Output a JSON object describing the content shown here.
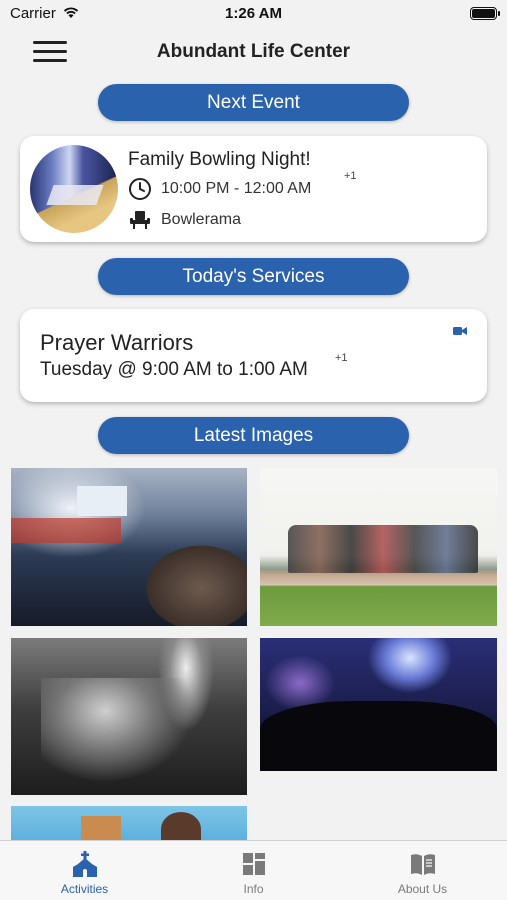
{
  "status_bar": {
    "carrier": "Carrier",
    "time": "1:26 AM"
  },
  "nav": {
    "title": "Abundant Life Center",
    "menu_icon": "hamburger-menu-icon"
  },
  "sections": {
    "next_event": "Next Event",
    "todays_services": "Today's Services",
    "latest_images": "Latest Images"
  },
  "event": {
    "title": "Family Bowling Night!",
    "time": "10:00 PM - 12:00 AM",
    "time_extra": "+1",
    "location": "Bowlerama",
    "time_icon": "clock-icon",
    "location_icon": "seat-icon"
  },
  "service": {
    "title": "Prayer Warriors",
    "when": "Tuesday @ 9:00 AM to 1:00 AM",
    "when_extra": "+1",
    "icon": "video-camera-icon"
  },
  "tabs": [
    {
      "label": "Activities",
      "icon": "church-icon",
      "active": true
    },
    {
      "label": "Info",
      "icon": "grid-icon",
      "active": false
    },
    {
      "label": "About Us",
      "icon": "book-icon",
      "active": false
    }
  ],
  "colors": {
    "accent": "#2b62ad",
    "background": "#f2f2f2",
    "inactive_tab": "#7a7a7a"
  }
}
